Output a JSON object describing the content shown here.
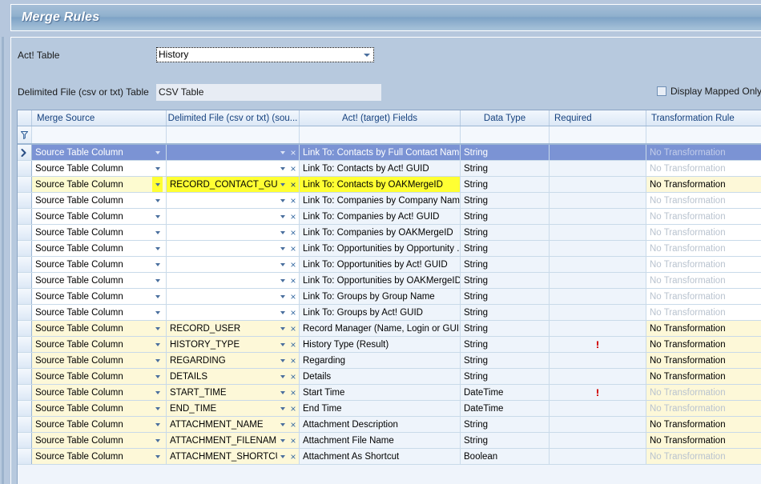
{
  "window": {
    "title": "Merge Rules"
  },
  "form": {
    "act_table_label": "Act! Table",
    "act_table_value": "History",
    "delimited_table_label": "Delimited File (csv or txt) Table",
    "delimited_table_value": "CSV Table",
    "display_mapped_only_label": "Display Mapped Only",
    "display_mapped_only_checked": "false"
  },
  "grid": {
    "columns": [
      {
        "key": "merge_source",
        "label": "Merge Source"
      },
      {
        "key": "delimited_file",
        "label": "Delimited File (csv or txt) (sou..."
      },
      {
        "key": "act_fields",
        "label": "Act! (target) Fields"
      },
      {
        "key": "data_type",
        "label": "Data Type"
      },
      {
        "key": "required",
        "label": "Required"
      },
      {
        "key": "transformation_rule",
        "label": "Transformation Rule"
      }
    ],
    "filter_icon": "funnel-icon",
    "source_default": "Source Table Column",
    "clear_glyph": "×",
    "required_glyph": "!",
    "no_transformation": "No Transformation",
    "rows": [
      {
        "source": "Source Table Column",
        "delimited": "",
        "act_field": "Link To: Contacts by Full Contact Name",
        "data_type": "String",
        "required": "",
        "transformation": "No Transformation",
        "state": "selected",
        "mapped": "false"
      },
      {
        "source": "Source Table Column",
        "delimited": "",
        "act_field": "Link To: Contacts by Act! GUID",
        "data_type": "String",
        "required": "",
        "transformation": "No Transformation",
        "state": "normal",
        "mapped": "false"
      },
      {
        "source": "Source Table Column",
        "delimited": "RECORD_CONTACT_GUID",
        "act_field": "Link To: Contacts by OAKMergeID",
        "data_type": "String",
        "required": "",
        "transformation": "No Transformation",
        "state": "highlight",
        "mapped": "true"
      },
      {
        "source": "Source Table Column",
        "delimited": "",
        "act_field": "Link To: Companies by Company Name",
        "data_type": "String",
        "required": "",
        "transformation": "No Transformation",
        "state": "normal",
        "mapped": "false"
      },
      {
        "source": "Source Table Column",
        "delimited": "",
        "act_field": "Link To: Companies by Act! GUID",
        "data_type": "String",
        "required": "",
        "transformation": "No Transformation",
        "state": "normal",
        "mapped": "false"
      },
      {
        "source": "Source Table Column",
        "delimited": "",
        "act_field": "Link To: Companies by OAKMergeID",
        "data_type": "String",
        "required": "",
        "transformation": "No Transformation",
        "state": "normal",
        "mapped": "false"
      },
      {
        "source": "Source Table Column",
        "delimited": "",
        "act_field": "Link To: Opportunities by Opportunity ...",
        "data_type": "String",
        "required": "",
        "transformation": "No Transformation",
        "state": "normal",
        "mapped": "false"
      },
      {
        "source": "Source Table Column",
        "delimited": "",
        "act_field": "Link To: Opportunities by Act! GUID",
        "data_type": "String",
        "required": "",
        "transformation": "No Transformation",
        "state": "normal",
        "mapped": "false"
      },
      {
        "source": "Source Table Column",
        "delimited": "",
        "act_field": "Link To: Opportunities by OAKMergeID",
        "data_type": "String",
        "required": "",
        "transformation": "No Transformation",
        "state": "normal",
        "mapped": "false"
      },
      {
        "source": "Source Table Column",
        "delimited": "",
        "act_field": "Link To: Groups by Group Name",
        "data_type": "String",
        "required": "",
        "transformation": "No Transformation",
        "state": "normal",
        "mapped": "false"
      },
      {
        "source": "Source Table Column",
        "delimited": "",
        "act_field": "Link To: Groups by Act! GUID",
        "data_type": "String",
        "required": "",
        "transformation": "No Transformation",
        "state": "normal",
        "mapped": "false"
      },
      {
        "source": "Source Table Column",
        "delimited": "RECORD_USER",
        "act_field": "Record Manager (Name, Login or GUID)",
        "data_type": "String",
        "required": "",
        "transformation": "No Transformation",
        "state": "mapped",
        "mapped": "true"
      },
      {
        "source": "Source Table Column",
        "delimited": "HISTORY_TYPE",
        "act_field": "History Type (Result)",
        "data_type": "String",
        "required": "!",
        "transformation": "No Transformation",
        "state": "mapped",
        "mapped": "true"
      },
      {
        "source": "Source Table Column",
        "delimited": "REGARDING",
        "act_field": "Regarding",
        "data_type": "String",
        "required": "",
        "transformation": "No Transformation",
        "state": "mapped",
        "mapped": "true"
      },
      {
        "source": "Source Table Column",
        "delimited": "DETAILS",
        "act_field": "Details",
        "data_type": "String",
        "required": "",
        "transformation": "No Transformation",
        "state": "mapped",
        "mapped": "true"
      },
      {
        "source": "Source Table Column",
        "delimited": "START_TIME",
        "act_field": "Start Time",
        "data_type": "DateTime",
        "required": "!",
        "transformation": "No Transformation",
        "state": "mapped",
        "mapped": "true"
      },
      {
        "source": "Source Table Column",
        "delimited": "END_TIME",
        "act_field": "End Time",
        "data_type": "DateTime",
        "required": "",
        "transformation": "No Transformation",
        "state": "mapped",
        "mapped": "true"
      },
      {
        "source": "Source Table Column",
        "delimited": "ATTACHMENT_NAME",
        "act_field": "Attachment Description",
        "data_type": "String",
        "required": "",
        "transformation": "No Transformation",
        "state": "mapped",
        "mapped": "true"
      },
      {
        "source": "Source Table Column",
        "delimited": "ATTACHMENT_FILENAME",
        "act_field": "Attachment File Name",
        "data_type": "String",
        "required": "",
        "transformation": "No Transformation",
        "state": "mapped",
        "mapped": "true"
      },
      {
        "source": "Source Table Column",
        "delimited": "ATTACHMENT_SHORTCUT",
        "act_field": "Attachment As Shortcut",
        "data_type": "Boolean",
        "required": "",
        "transformation": "No Transformation",
        "state": "mapped",
        "mapped": "true"
      }
    ],
    "dim_transformation_rows": [
      0,
      1,
      3,
      4,
      5,
      6,
      7,
      8,
      9,
      10,
      15,
      16,
      19
    ]
  },
  "colors": {
    "title_bar": "#8fb0cd",
    "panel": "#b7c9de",
    "selection": "#7b93d4",
    "highlight_yellow": "#ffff33",
    "mapped_row": "#fdf8d8",
    "required_red": "#d00000",
    "header_text": "#15417e"
  }
}
